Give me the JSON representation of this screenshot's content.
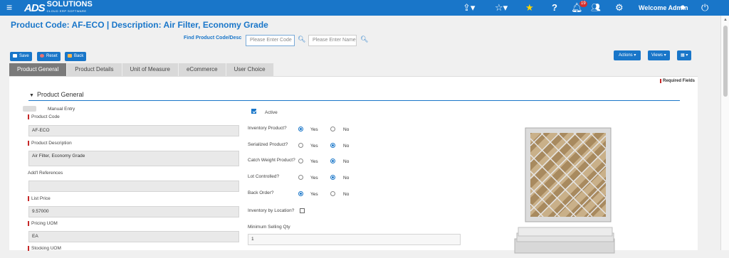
{
  "header": {
    "logo_mark": "ADS",
    "logo_word": "SOLUTIONS",
    "logo_tagline": "CLOUD ERP SOFTWARE",
    "notification_count": "19",
    "welcome": "Welcome Admin",
    "icons": [
      "menu-icon",
      "share-icon",
      "star-outline-icon",
      "star-filled-icon",
      "help-icon",
      "bell-icon",
      "users-icon",
      "gear-icon",
      "user-circle-icon",
      "power-icon"
    ]
  },
  "page": {
    "title": "Product Code:  AF-ECO | Description: Air Filter, Economy Grade",
    "find_label": "Find Product Code/Desc",
    "code_placeholder": "Please Enter Code",
    "name_placeholder": "Please Enter Name"
  },
  "toolbar": {
    "save": "Save",
    "reset": "Reset",
    "back": "Back",
    "actions": "Actions",
    "views": "Views"
  },
  "tabs": [
    "Product General",
    "Product Details",
    "Unit of Measure",
    "eCommerce",
    "User Choice"
  ],
  "form": {
    "required_fields": "Required Fields",
    "section_title": "Product General",
    "manual_entry": "Manual Entry",
    "product_code_label": "Product Code",
    "product_code_value": "AF-ECO",
    "product_desc_label": "Product Description",
    "product_desc_value": "Air Filter, Economy Grade",
    "addl_ref_label": "Add'l References",
    "addl_ref_value": "",
    "list_price_label": "List Price",
    "list_price_value": "9.57000",
    "pricing_uom_label": "Pricing UOM",
    "pricing_uom_value": "EA",
    "stocking_uom_label": "Stocking UOM",
    "active_label": "Active",
    "inventory_product_label": "Inventory Product?",
    "serialized_product_label": "Serialized Product?",
    "catch_weight_label": "Catch Weight Product?",
    "lot_controlled_label": "Lot Controlled?",
    "back_order_label": "Back Order?",
    "yes": "Yes",
    "no": "No",
    "inventory_by_location_label": "Inventory by Location?",
    "min_selling_qty_label": "Minimum Selling Qty",
    "min_selling_qty_value": "1",
    "radios": {
      "inventory_product": "Yes",
      "serialized_product": "No",
      "catch_weight": "No",
      "lot_controlled": "No",
      "back_order": "Yes"
    }
  },
  "colors": {
    "brand": "#1976c9",
    "required": "#c62828"
  }
}
